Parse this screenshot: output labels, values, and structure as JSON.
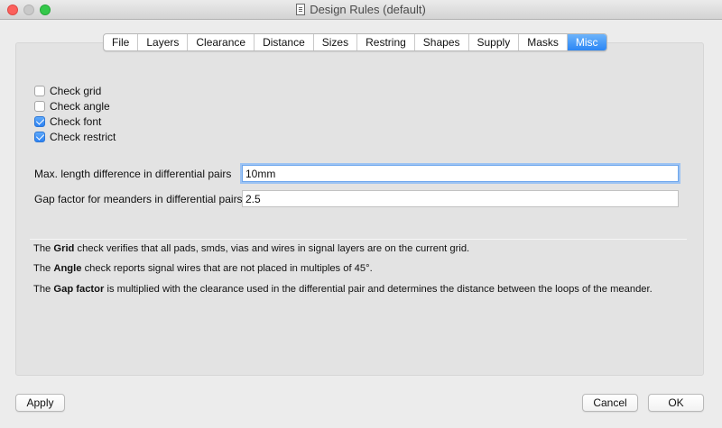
{
  "window": {
    "title": "Design Rules (default)"
  },
  "tabs": [
    {
      "label": "File",
      "active": false
    },
    {
      "label": "Layers",
      "active": false
    },
    {
      "label": "Clearance",
      "active": false
    },
    {
      "label": "Distance",
      "active": false
    },
    {
      "label": "Sizes",
      "active": false
    },
    {
      "label": "Restring",
      "active": false
    },
    {
      "label": "Shapes",
      "active": false
    },
    {
      "label": "Supply",
      "active": false
    },
    {
      "label": "Masks",
      "active": false
    },
    {
      "label": "Misc",
      "active": true
    }
  ],
  "checks": [
    {
      "label": "Check grid",
      "checked": false
    },
    {
      "label": "Check angle",
      "checked": false
    },
    {
      "label": "Check font",
      "checked": true
    },
    {
      "label": "Check restrict",
      "checked": true
    }
  ],
  "fields": {
    "max_length": {
      "label": "Max. length difference in differential pairs",
      "value": "10mm"
    },
    "gap_factor": {
      "label": "Gap factor for meanders in differential pairs",
      "value": "2.5"
    }
  },
  "help": {
    "grid": {
      "pre": "The ",
      "bold": "Grid",
      "post": " check verifies that all pads, smds, vias and wires in signal layers are on the current grid."
    },
    "angle": {
      "pre": "The ",
      "bold": "Angle",
      "post": " check reports signal wires that are not placed in multiples of 45°."
    },
    "gap": {
      "pre": "The ",
      "bold": "Gap factor",
      "post": " is multiplied with the clearance used in the differential pair and determines the distance between the loops of the meander."
    }
  },
  "buttons": {
    "apply": "Apply",
    "cancel": "Cancel",
    "ok": "OK"
  },
  "colors": {
    "accent": "#2b86f5",
    "close": "#fc605c",
    "zoom": "#34c84a"
  }
}
